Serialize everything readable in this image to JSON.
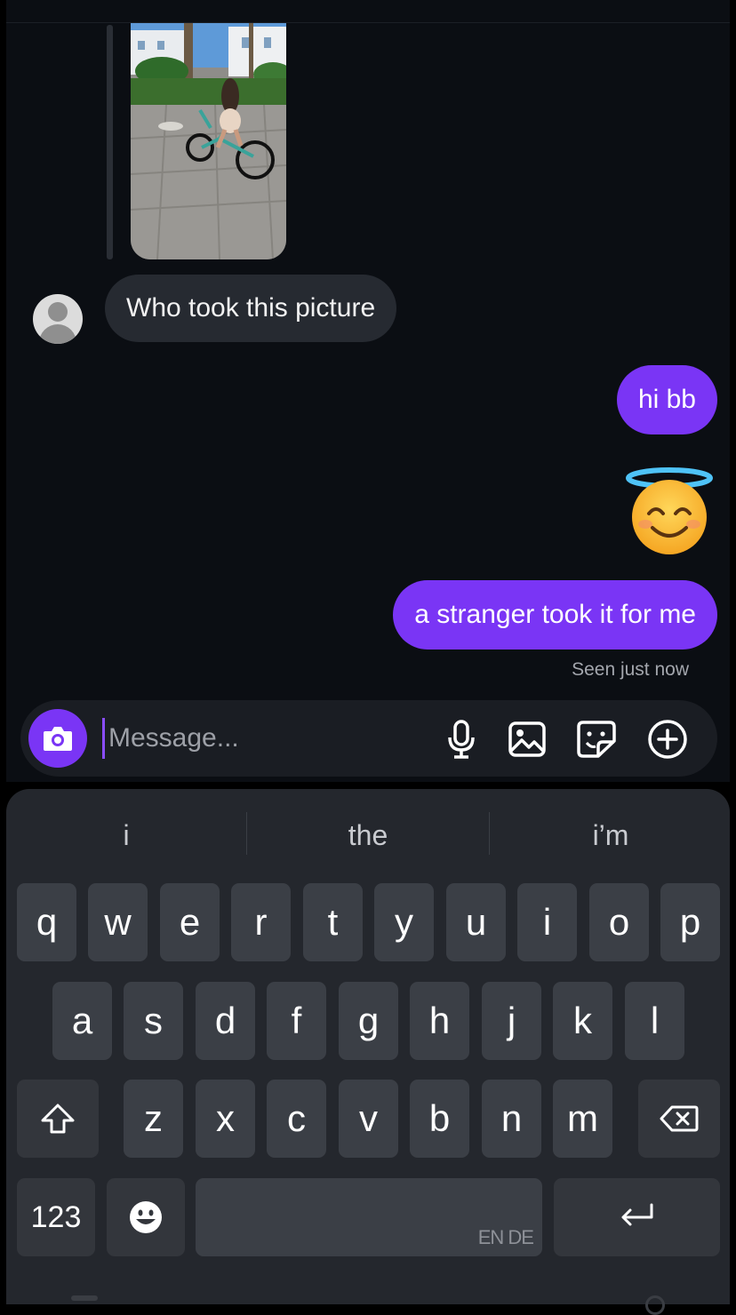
{
  "messages": {
    "incoming_text": "Who took this picture",
    "outgoing_1": "hi bb",
    "outgoing_emoji": "smiling-face-with-halo",
    "outgoing_2": "a stranger took it for me",
    "seen": "Seen just now"
  },
  "composer": {
    "placeholder": "Message..."
  },
  "keyboard": {
    "suggestions": [
      "i",
      "the",
      "i’m"
    ],
    "row1": [
      "q",
      "w",
      "e",
      "r",
      "t",
      "y",
      "u",
      "i",
      "o",
      "p"
    ],
    "row2": [
      "a",
      "s",
      "d",
      "f",
      "g",
      "h",
      "j",
      "k",
      "l"
    ],
    "row3": [
      "z",
      "x",
      "c",
      "v",
      "b",
      "n",
      "m"
    ],
    "numbers_key": "123",
    "space_lang": "EN DE"
  },
  "colors": {
    "accent": "#7a35f5",
    "chat_bg": "#0b0e13",
    "incoming_bubble": "#262a31"
  }
}
